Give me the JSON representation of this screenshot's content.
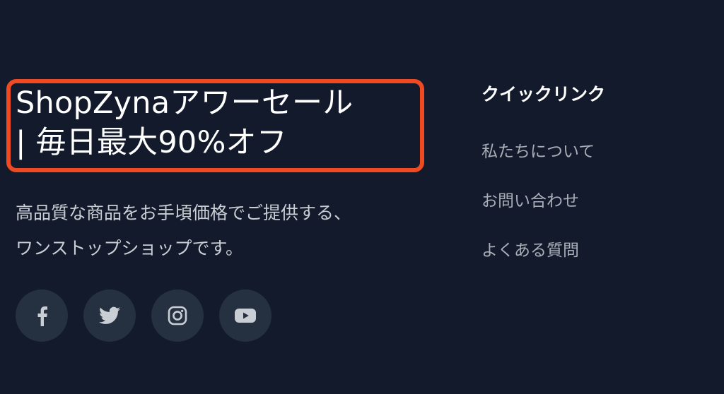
{
  "brand": {
    "headline_line1": "ShopZynaアワーセール",
    "headline_line2": "| 毎日最大90%オフ",
    "description_line1": "高品質な商品をお手頃価格でご提供する、",
    "description_line2": "ワンストップショップです。",
    "highlight_color": "#f04a23"
  },
  "social": [
    {
      "icon": "facebook-icon"
    },
    {
      "icon": "twitter-icon"
    },
    {
      "icon": "instagram-icon"
    },
    {
      "icon": "youtube-icon"
    }
  ],
  "quick_links": {
    "title": "クイックリンク",
    "items": [
      {
        "label": "私たちについて"
      },
      {
        "label": "お問い合わせ"
      },
      {
        "label": "よくある質問"
      }
    ]
  },
  "colors": {
    "background": "#121a2b",
    "social_button_bg": "#253041",
    "icon": "#c9cdd4",
    "link_text": "#a9aeb7"
  }
}
